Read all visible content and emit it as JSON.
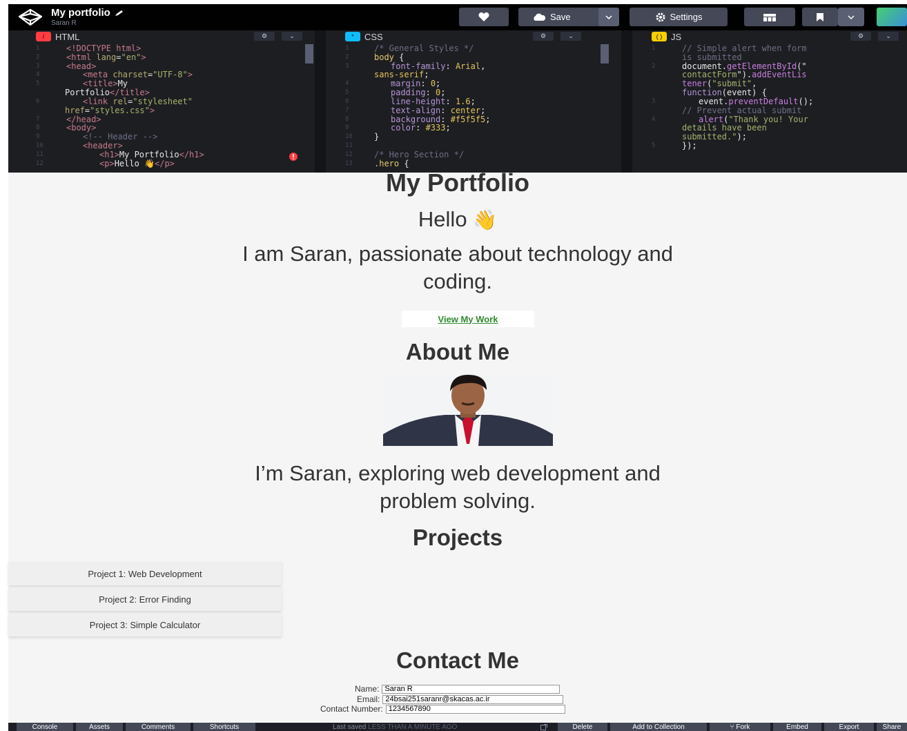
{
  "app": {
    "pen_title": "My portfolio",
    "author": "Saran R",
    "save_label": "Save",
    "settings_label": "Settings"
  },
  "panels": {
    "html": {
      "label": "HTML",
      "badge_color": "#ff3c41"
    },
    "css": {
      "label": "CSS",
      "badge_color": "#0ebeff"
    },
    "js": {
      "label": "JS",
      "badge_color": "#fcd000"
    }
  },
  "code": {
    "html_lines": [
      "1",
      "2",
      "3",
      "4",
      "5",
      "",
      "6",
      "",
      "7",
      "8",
      "9",
      "10",
      "11",
      "12"
    ],
    "css_lines": [
      "1",
      "2",
      "3",
      "",
      "4",
      "5",
      "6",
      "7",
      "8",
      "9",
      "10",
      "11",
      "12",
      "13"
    ],
    "js_lines": [
      "1",
      "",
      "2",
      "",
      "",
      "3",
      "",
      "4",
      "",
      "",
      "5"
    ]
  },
  "preview": {
    "heading": "My Portfolio",
    "greeting": "Hello",
    "greeting_emoji": "👋",
    "intro_line1": "I am Saran, passionate about technology and",
    "intro_line2": "coding.",
    "cta": "View My Work",
    "about_heading": "About Me",
    "about_line1": "I’m Saran, exploring web development and",
    "about_line2": "problem solving.",
    "projects_heading": "Projects",
    "projects": [
      "Project 1: Web Development",
      "Project 2: Error Finding",
      "Project 3: Simple Calculator"
    ],
    "contact_heading": "Contact Me",
    "form": {
      "name_label": "Name:",
      "name_value": "Saran R",
      "email_label": "Email:",
      "email_value": "24bsai251saranr@skacas.ac.ir",
      "phone_label": "Contact Number:",
      "phone_value": "1234567890"
    }
  },
  "bottom": {
    "console": "Console",
    "assets": "Assets",
    "comments": "Comments",
    "shortcuts": "Shortcuts",
    "last_saved": "Last saved",
    "last_saved_time": "LESS THAN A MINUTE AGO",
    "delete": "Delete",
    "add_collection": "Add to Collection",
    "fork": "Fork",
    "embed": "Embed",
    "export": "Export",
    "share": "Share"
  }
}
